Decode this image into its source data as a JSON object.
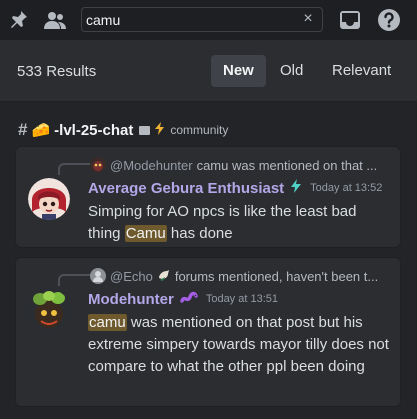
{
  "search": {
    "query": "camu",
    "clear_symbol": "×"
  },
  "results_header": {
    "count_label": "533 Results",
    "sort": {
      "new_label": "New",
      "old_label": "Old",
      "relevant_label": "Relevant",
      "active": "New"
    }
  },
  "channel": {
    "name": "-lvl-25-chat",
    "category": "community",
    "emoji": "🧀"
  },
  "messages": [
    {
      "reply": {
        "name": "@Modehunter",
        "text": "camu was mentioned on that ..."
      },
      "author": "Average Gebura Enthusiast",
      "author_color": "#b4a7e8",
      "badge_icon": "lightning-icon",
      "time": "Today at 13:52",
      "content_before": "Simping for AO npcs is like the least bad thing ",
      "highlight": "Camu",
      "content_after": " has done"
    },
    {
      "reply": {
        "name": "@Echo",
        "text": "forums mentioned, haven't been t..."
      },
      "author": "Modehunter",
      "author_color": "#b4a7e8",
      "badge_icon": "worm-icon",
      "time": "Today at 13:51",
      "content_before": "",
      "highlight": "camu",
      "content_after": " was mentioned on that post but his extreme simpery towards mayor tilly does not compare to what the other ppl been doing"
    }
  ],
  "colors": {
    "highlight_bg": "#6e5a2c",
    "author": "#b4a7e8",
    "topbar_bg": "#1e1f22",
    "panel_bg": "#232428"
  }
}
